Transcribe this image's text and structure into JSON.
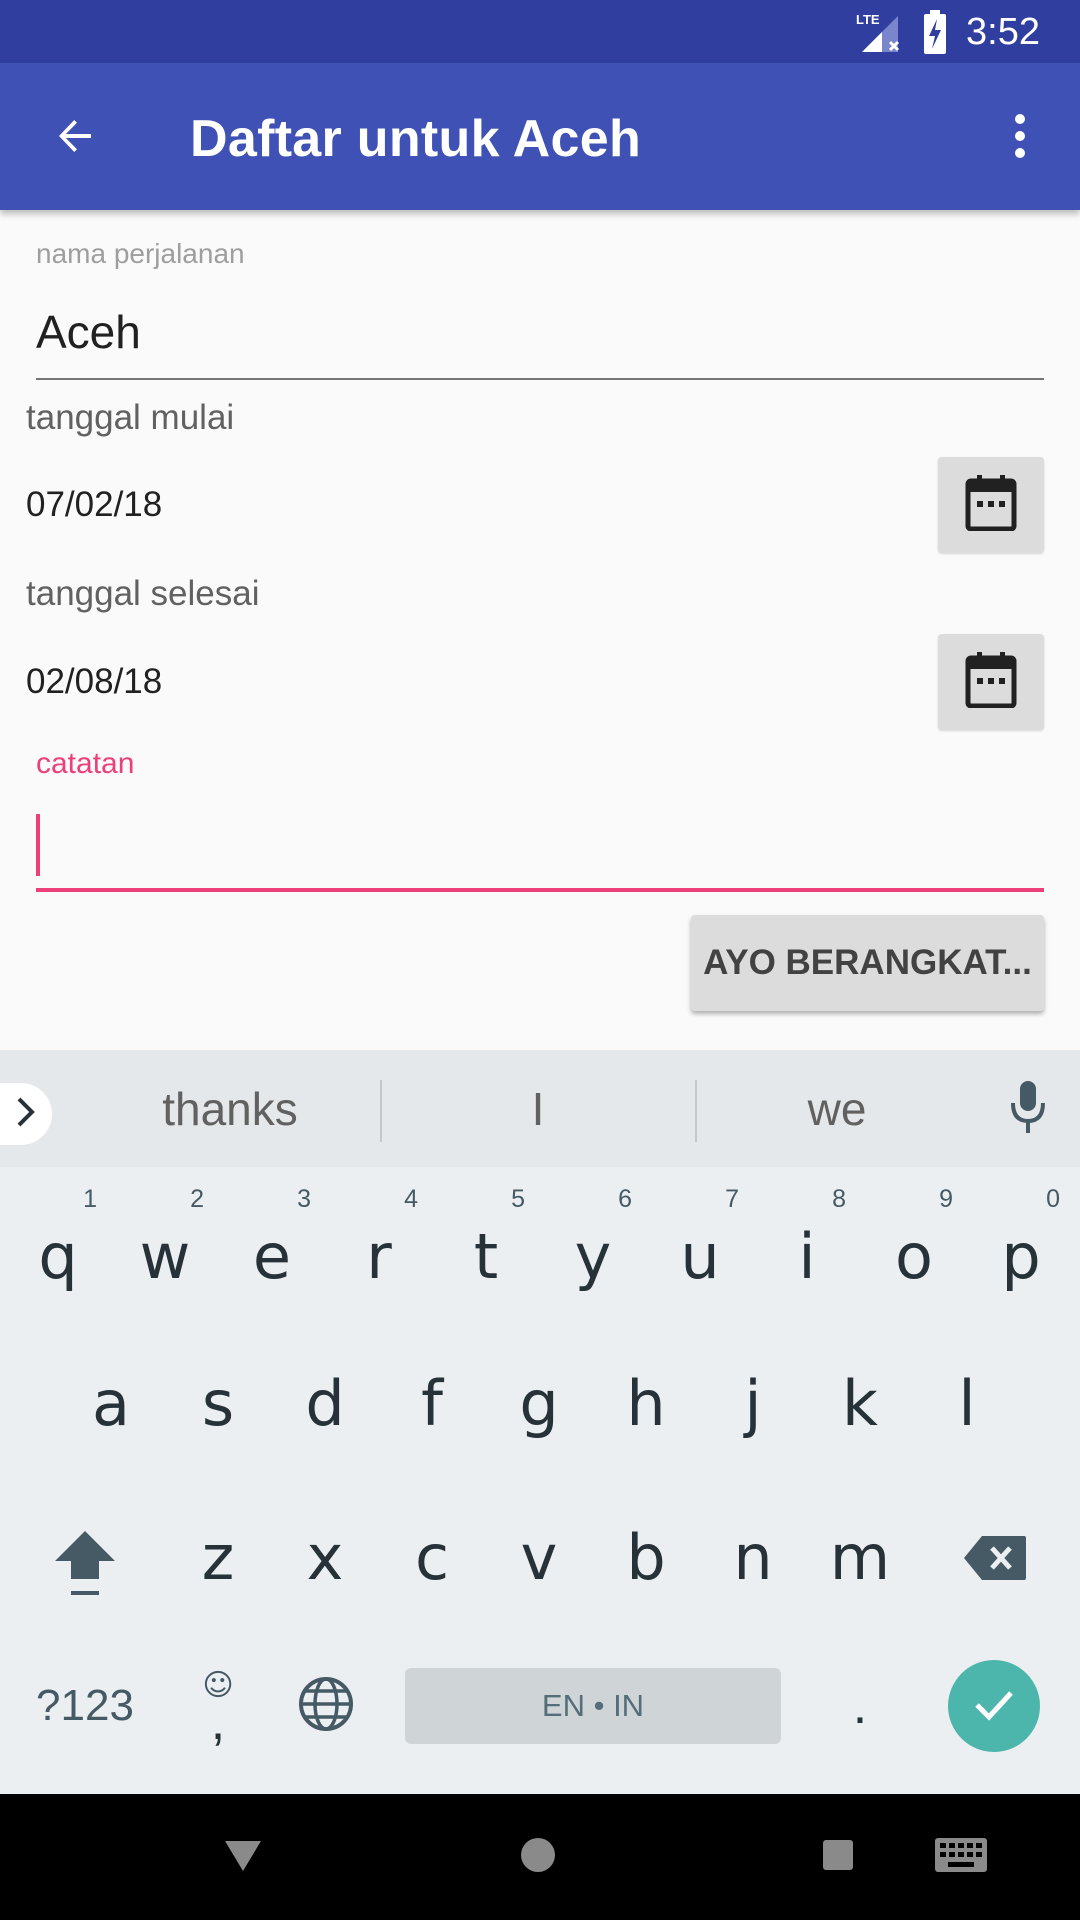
{
  "status_bar": {
    "time": "3:52",
    "network_label": "LTE",
    "icons": [
      "lte-signal-icon",
      "battery-charging-icon"
    ]
  },
  "app_bar": {
    "title": "Daftar untuk Aceh",
    "back_icon": "arrow-back-icon",
    "overflow_icon": "more-vert-icon"
  },
  "form": {
    "trip_name_label": "nama perjalanan",
    "trip_name_value": "Aceh",
    "start_date_label": "tanggal mulai",
    "start_date_value": "07/02/18",
    "end_date_label": "tanggal selesai",
    "end_date_value": "02/08/18",
    "notes_label": "catatan",
    "notes_value": "",
    "submit_label": "AYO BERANGKAT..."
  },
  "keyboard": {
    "suggestions": [
      "thanks",
      "I",
      "we"
    ],
    "row1": [
      {
        "key": "q",
        "hint": "1"
      },
      {
        "key": "w",
        "hint": "2"
      },
      {
        "key": "e",
        "hint": "3"
      },
      {
        "key": "r",
        "hint": "4"
      },
      {
        "key": "t",
        "hint": "5"
      },
      {
        "key": "y",
        "hint": "6"
      },
      {
        "key": "u",
        "hint": "7"
      },
      {
        "key": "i",
        "hint": "8"
      },
      {
        "key": "o",
        "hint": "9"
      },
      {
        "key": "p",
        "hint": "0"
      }
    ],
    "row2": [
      "a",
      "s",
      "d",
      "f",
      "g",
      "h",
      "j",
      "k",
      "l"
    ],
    "row3": [
      "z",
      "x",
      "c",
      "v",
      "b",
      "n",
      "m"
    ],
    "symbols_label": "?123",
    "comma_label": ",",
    "emoji_symbol": "☺",
    "space_label": "EN • IN",
    "period_label": "."
  },
  "colors": {
    "status_bar": "#303f9f",
    "app_bar": "#3f51b5",
    "accent": "#ec407a",
    "enter_key": "#4db6ac"
  }
}
